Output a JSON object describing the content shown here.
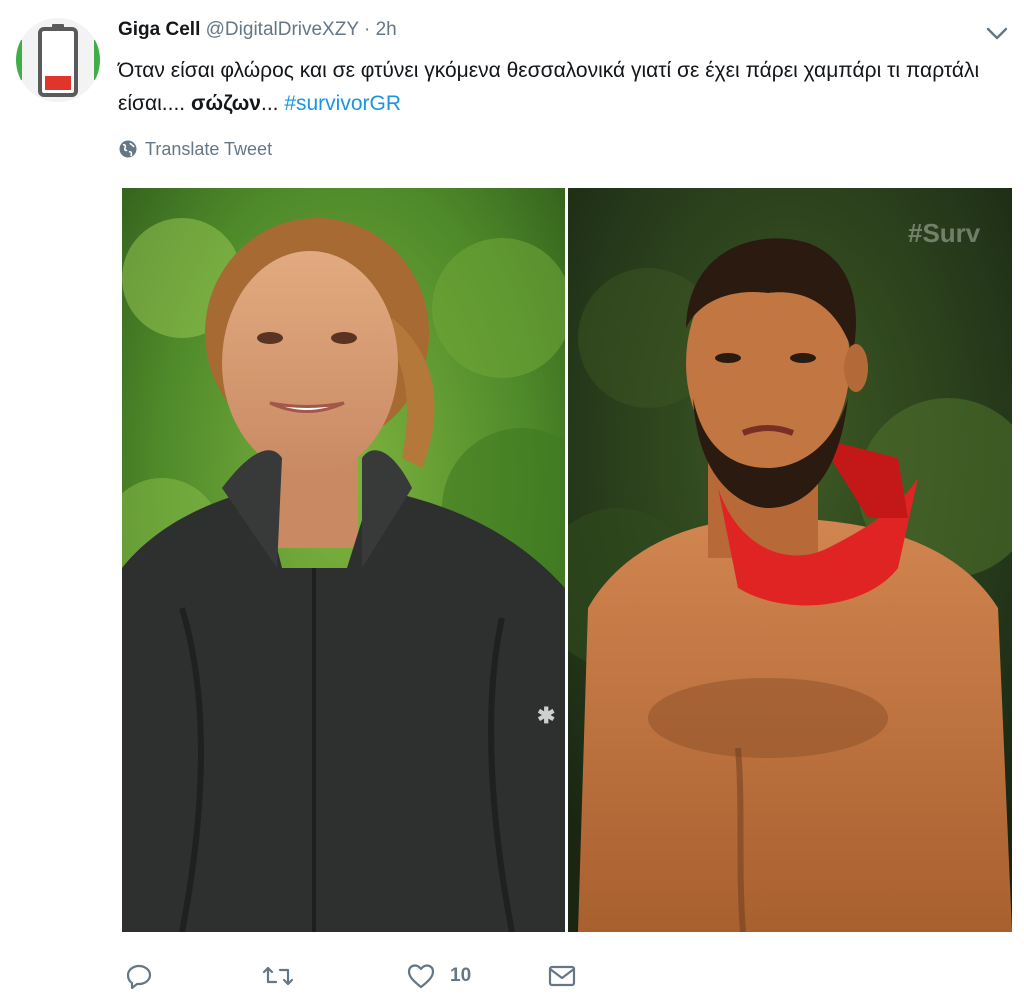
{
  "tweet": {
    "author_name": "Giga Cell",
    "author_handle": "@DigitalDriveXZY",
    "separator": "·",
    "time": "2h",
    "text_part1": "Όταν είσαι φλώρος και σε φτύνει γκόμενα θεσσαλονικά γιατί σε έχει πάρει χαμπάρι τι παρτάλι είσαι.... ",
    "text_bold": "σώζων",
    "text_part2": "... ",
    "hashtag": "#survivorGR",
    "translate_label": "Translate Tweet",
    "media_watermark": "#Surv",
    "likes_count": "10"
  },
  "icons": {
    "avatar": "battery-low-icon",
    "caret": "chevron-down-icon",
    "translate": "globe-icon",
    "reply": "reply-icon",
    "retweet": "retweet-icon",
    "like": "heart-icon",
    "dm": "envelope-icon"
  },
  "colors": {
    "text": "#14171a",
    "secondary": "#657786",
    "link": "#1b95e0",
    "battery_red": "#e0352b"
  }
}
